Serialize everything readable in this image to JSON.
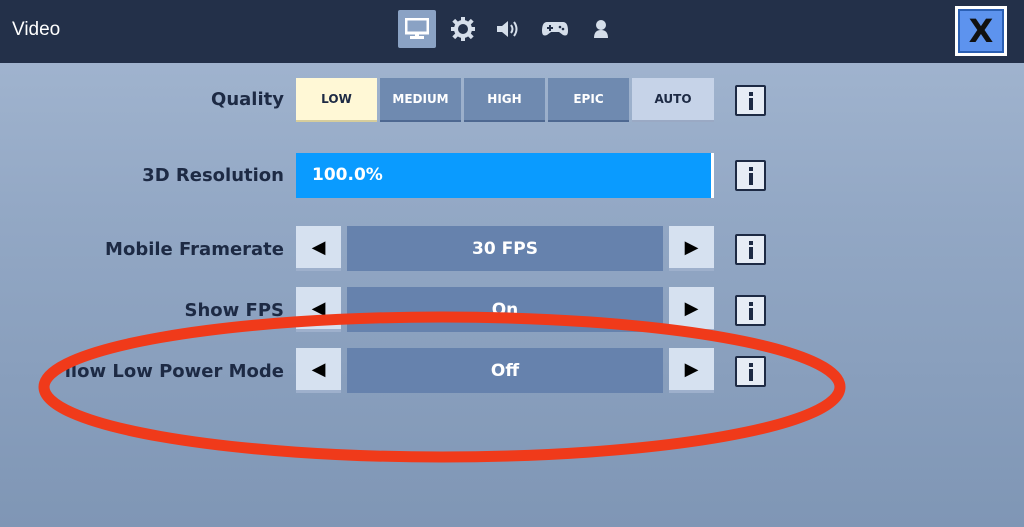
{
  "header": {
    "title": "Video",
    "tabs": [
      {
        "icon": "monitor-icon",
        "active": true
      },
      {
        "icon": "gear-icon",
        "active": false
      },
      {
        "icon": "speaker-icon",
        "active": false
      },
      {
        "icon": "gamepad-icon",
        "active": false
      },
      {
        "icon": "person-icon",
        "active": false
      }
    ],
    "close_label": "X"
  },
  "settings": {
    "quality": {
      "label": "Quality",
      "options": [
        "LOW",
        "MEDIUM",
        "HIGH",
        "EPIC",
        "AUTO"
      ],
      "selected": "LOW"
    },
    "resolution": {
      "label": "3D Resolution",
      "value_text": "100.0%",
      "fill_fraction": 1.0
    },
    "framerate": {
      "label": "Mobile Framerate",
      "value": "30 FPS"
    },
    "show_fps": {
      "label": "Show FPS",
      "value": "On"
    },
    "low_power": {
      "label": "llow Low Power Mode",
      "value": "Off"
    }
  },
  "glyphs": {
    "left_arrow": "◀",
    "right_arrow": "▶"
  },
  "colors": {
    "topbar": "#233049",
    "accent_blue": "#0a9bff",
    "annotation": "#f03a1a"
  }
}
